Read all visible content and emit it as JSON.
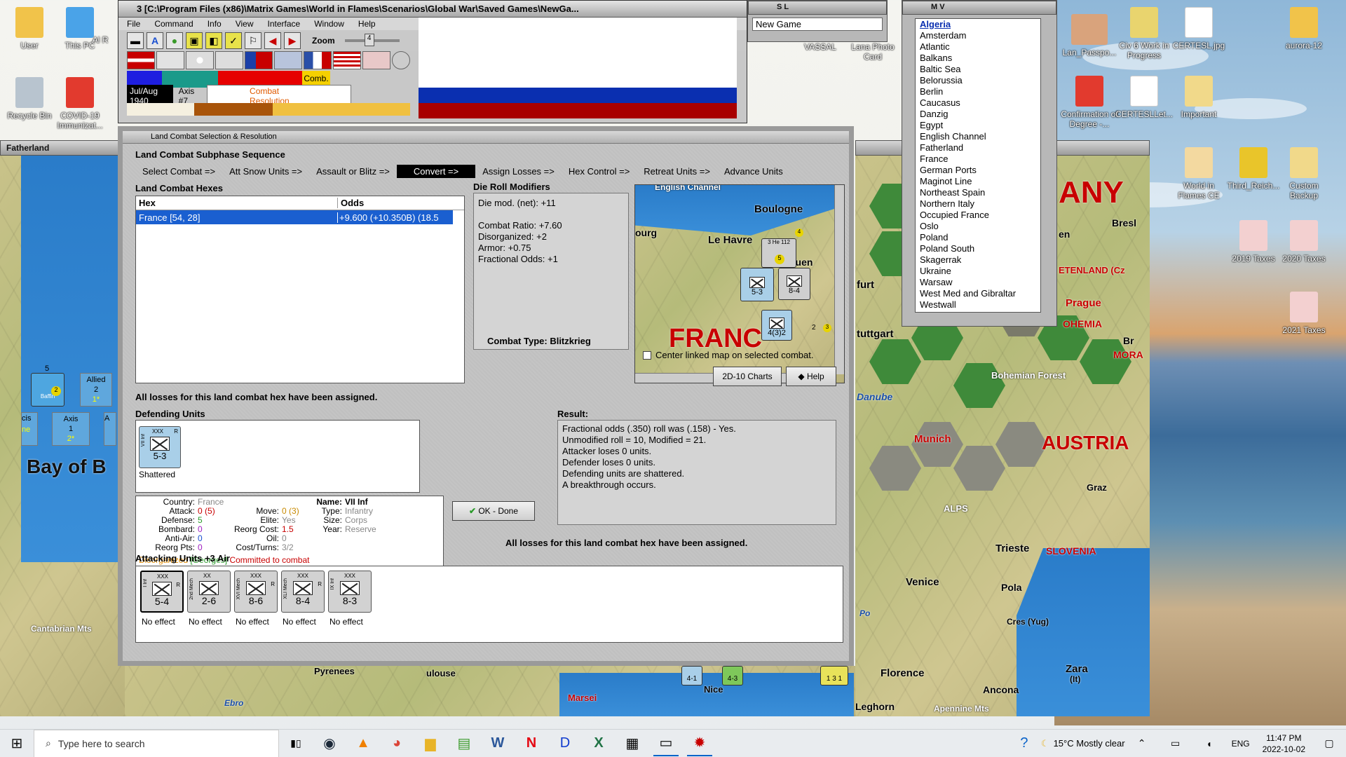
{
  "app": {
    "title": "3 [C:\\Program Files (x86)\\Matrix Games\\World in Flames\\Scenarios\\Global War\\Saved Games\\NewGa...",
    "menu": [
      "File",
      "Command",
      "Info",
      "View",
      "Interface",
      "Window",
      "Help"
    ],
    "zoom_label": "Zoom",
    "zoom_value": "4",
    "date": "Jul/Aug 1940",
    "turn": "Axis #7",
    "phase": "Combat Resolution",
    "comb_label": "Comb."
  },
  "sl_window": {
    "title": "S L",
    "value": "New Game"
  },
  "mv_window": {
    "title": "M V",
    "items": [
      "Algeria",
      "Amsterdam",
      "Atlantic",
      "Balkans",
      "Baltic Sea",
      "Belorussia",
      "Berlin",
      "Caucasus",
      "Danzig",
      "Egypt",
      "English Channel",
      "Fatherland",
      "France",
      "German Ports",
      "Maginot Line",
      "Northeast Spain",
      "Northern Italy",
      "Occupied France",
      "Oslo",
      "Poland",
      "Poland South",
      "Skagerrak",
      "Ukraine",
      "Warsaw",
      "West Med and Gibraltar",
      "Westwall"
    ]
  },
  "left_map": {
    "title": "Fatherland",
    "labels": {
      "bay": "Bay of B",
      "mts": "Cantabrian Mts",
      "pyrenees": "Pyrenees",
      "ebro": "Ebro",
      "marsei": "Marsei",
      "ulouse": "ulouse",
      "nice": "Nice"
    },
    "allied": {
      "label": "Allied",
      "val1": "2",
      "val2": "1*"
    },
    "axis": {
      "label": "Axis",
      "val1": "1",
      "val2": "2*"
    },
    "counter_top": "5",
    "counter_name": "Baffin",
    "counter_num": "2",
    "frag_cis": "cis",
    "frag_ne": "ne",
    "frag_a": "A",
    "unit_41": "4-1",
    "unit_43": "4-3",
    "unit_131": "1 3 1"
  },
  "right_map": {
    "labels": {
      "any": "ANY",
      "bresl": "Bresl",
      "prague": "Prague",
      "bohemia": "OHEMIA",
      "mora": "MORA",
      "bru": "Br",
      "bohemian": "Bohemian Forest",
      "danube": "Danube",
      "munich": "Munich",
      "austria": "AUSTRIA",
      "graz": "Graz",
      "alps": "ALPS",
      "trieste": "Trieste",
      "slovenia": "SLOVENIA",
      "venice": "Venice",
      "pola": "Pola",
      "cres": "Cres (Yug)",
      "zara": "Zara",
      "zara2": "(It)",
      "florence": "Florence",
      "ancona": "Ancona",
      "leghorn": "Leghorn",
      "apennine": "Apennine Mts",
      "po": "Po",
      "stuttgart": "tuttgart",
      "furt": "furt",
      "sudeten": "ETENLAND (Cz",
      "en": "en"
    }
  },
  "dialog": {
    "title": "Land Combat Selection & Resolution",
    "sequence_title": "Land Combat Subphase Sequence",
    "sequence": [
      "Select Combat =>",
      "Att Snow Units =>",
      "Assault or Blitz =>",
      "Convert =>",
      "Assign Losses =>",
      "Hex Control =>",
      "Retreat Units =>",
      "Advance Units"
    ],
    "sequence_current": 3,
    "hexes_title": "Land Combat Hexes",
    "hexes_cols": [
      "Hex",
      "Odds"
    ],
    "hexes_rows": [
      {
        "hex": "France [54, 28]",
        "odds": "+9.600 (+10.350B) (18.5"
      }
    ],
    "die_title": "Die Roll Modifiers",
    "die_lines": [
      "Die mod. (net): +11",
      "",
      "Combat Ratio: +7.60",
      "Disorganized: +2",
      "Armor: +0.75",
      "Fractional Odds: +1"
    ],
    "combat_type": "Combat Type:  Blitzkrieg",
    "center_linked": "Center linked map on selected combat.",
    "charts_button": "2D-10 Charts",
    "help_button": "Help",
    "losses_msg": "All losses for this land combat hex have been assigned.",
    "defending_title": "Defending Units",
    "defender": {
      "label": "VII Inf",
      "size": "XXX",
      "value": "5-3",
      "status": "Shattered",
      "r": "R"
    },
    "result_title": "Result:",
    "result_lines": [
      "Fractional odds (.350) roll was (.158)  - Yes.",
      "Unmodified roll = 10, Modified = 21.",
      "Attacker loses 0 units.",
      "Defender loses 0 units.",
      "Defending units are shattered.",
      "A breakthrough occurs."
    ],
    "ok_button": "OK - Done",
    "losses_msg2": "All losses for this land combat hex have been assigned.",
    "info": {
      "country_k": "Country:",
      "country_v": "France",
      "attack_k": "Attack:",
      "attack_v": "0",
      "attack_v2": "(5)",
      "defense_k": "Defense:",
      "defense_v": "5",
      "bombard_k": "Bombard:",
      "bombard_v": "0",
      "antiair_k": "Anti-Air:",
      "antiair_v": "0",
      "reorg_k": "Reorg Pts:",
      "reorg_v": "0",
      "name_k": "Name:",
      "name_v": "VII Inf",
      "move_k": "Move:",
      "move_v": "0",
      "move_v2": "(3)",
      "elite_k": "Elite:",
      "elite_v": "Yes",
      "reorgcost_k": "Reorg Cost:",
      "reorgcost_v": "1.5",
      "oil_k": "Oil:",
      "oil_v": "0",
      "cost_k": "Cost/Turns:",
      "cost_v": "3/2",
      "type_k": "Type:",
      "type_v": "Infantry",
      "size_k": "Size:",
      "size_v": "Corps",
      "year_k": "Year:",
      "year_v": "Reserve",
      "status1": "Disorganized",
      "status2": "[Georges]",
      "status3": "Committed to combat"
    },
    "attacking_title": "Attacking Units +3 Air",
    "attackers": [
      {
        "name": "I Inf",
        "size": "XXX",
        "value": "5-4",
        "status": "No effect",
        "r": "R"
      },
      {
        "name": "2nd Mech",
        "size": "XX",
        "value": "2-6",
        "status": "No effect",
        "r": ""
      },
      {
        "name": "XVI Mech",
        "size": "XXX",
        "value": "8-6",
        "status": "No effect",
        "r": "R"
      },
      {
        "name": "XLI Mech",
        "size": "XXX",
        "value": "8-4",
        "status": "No effect",
        "r": "R"
      },
      {
        "name": "IX Inf",
        "size": "XXX",
        "value": "8-3",
        "status": "No effect",
        "r": ""
      }
    ],
    "minimap": {
      "boulogne": "Boulogne",
      "lehavre": "Le Havre",
      "ourg": "ourg",
      "ouen": "ouen",
      "franc": "FRANC",
      "channel": "English Channel",
      "unit1": "5-3",
      "unit2": "8-4",
      "unit3": "4(3)2",
      "air": "3 He 112",
      "v5": "5",
      "v4": "4",
      "v3": "3",
      "v2": "2"
    }
  },
  "desktop": {
    "icons_left": [
      {
        "label": "User"
      },
      {
        "label": "This PC"
      },
      {
        "label": "Al R"
      },
      {
        "label": "Recycle Bin"
      },
      {
        "label": "COVID-19 Immunizat..."
      }
    ],
    "icons_mid": [
      {
        "label": "VASSAL"
      },
      {
        "label": "Lana Photo Card"
      }
    ],
    "icons_right": [
      {
        "label": "Lan_Passpo..."
      },
      {
        "label": "Civ 6 Work in Progress"
      },
      {
        "label": "CERTESL.jpg"
      },
      {
        "label": "aurora-12"
      },
      {
        "label": "Confirmation of Degree -..."
      },
      {
        "label": "CERTESLLet..."
      },
      {
        "label": "Important"
      },
      {
        "label": "World in Flames CE"
      },
      {
        "label": "Third_Reich..."
      },
      {
        "label": "Custom Backup"
      },
      {
        "label": "2019 Taxes"
      },
      {
        "label": "2020 Taxes"
      },
      {
        "label": "2021 Taxes"
      }
    ]
  },
  "taskbar": {
    "search_placeholder": "Type here to search",
    "weather": "15°C  Mostly clear",
    "lang": "ENG",
    "time": "11:47 PM",
    "date": "2022-10-02"
  },
  "colors": {
    "accent": "#0a63c9",
    "select": "#1a5fd0",
    "sea": "#2a7cc9",
    "red": "#c80000",
    "hexgreen": "#3f8a3a"
  }
}
